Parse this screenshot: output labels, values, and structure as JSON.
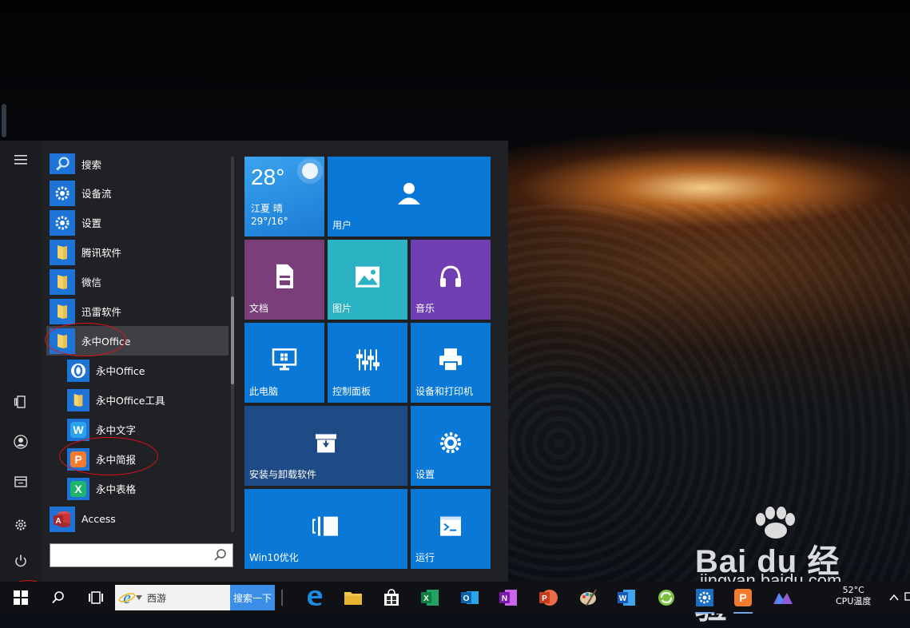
{
  "app_list": [
    {
      "label": "搜索",
      "icon": "search-app-icon"
    },
    {
      "label": "设备流",
      "icon": "gear-app-icon"
    },
    {
      "label": "设置",
      "icon": "gear-app-icon"
    },
    {
      "label": "腾讯软件",
      "icon": "folder-icon"
    },
    {
      "label": "微信",
      "icon": "folder-icon"
    },
    {
      "label": "迅雷软件",
      "icon": "folder-icon"
    },
    {
      "label": "永中Office",
      "icon": "folder-icon"
    },
    {
      "label": "永中Office",
      "icon": "yozo-office-icon"
    },
    {
      "label": "永中Office工具",
      "icon": "folder-icon"
    },
    {
      "label": "永中文字",
      "icon": "yozo-writer-icon"
    },
    {
      "label": "永中简报",
      "icon": "yozo-presentation-icon"
    },
    {
      "label": "永中表格",
      "icon": "yozo-spreadsheet-icon"
    },
    {
      "label": "Access",
      "icon": "access-icon"
    }
  ],
  "search": {
    "value": ""
  },
  "tiles": {
    "weather": {
      "temp": "28°",
      "city": "江夏 晴",
      "range": "29°/16°"
    },
    "user": "用户",
    "documents": "文档",
    "pictures": "图片",
    "music": "音乐",
    "this_pc": "此电脑",
    "control_panel": "控制面板",
    "devices": "设备和打印机",
    "install": "安装与卸载软件",
    "settings": "设置",
    "win10": "Win10优化",
    "run": "运行"
  },
  "taskbar": {
    "search_text": "西游",
    "search_button": "搜索一下",
    "temp": "52°C",
    "cpu_label": "CPU温度"
  },
  "watermark": {
    "big": "Bai du 经验",
    "small": "jingyan.baidu.com"
  },
  "colors": {
    "tile_blue": "#0a78d7",
    "tile_purple": "#7a3f7a",
    "tile_teal": "#2bb2c3",
    "tile_violet": "#6f3fb3",
    "tile_navy": "#1e4b86",
    "annotation_red": "#e0101a"
  }
}
